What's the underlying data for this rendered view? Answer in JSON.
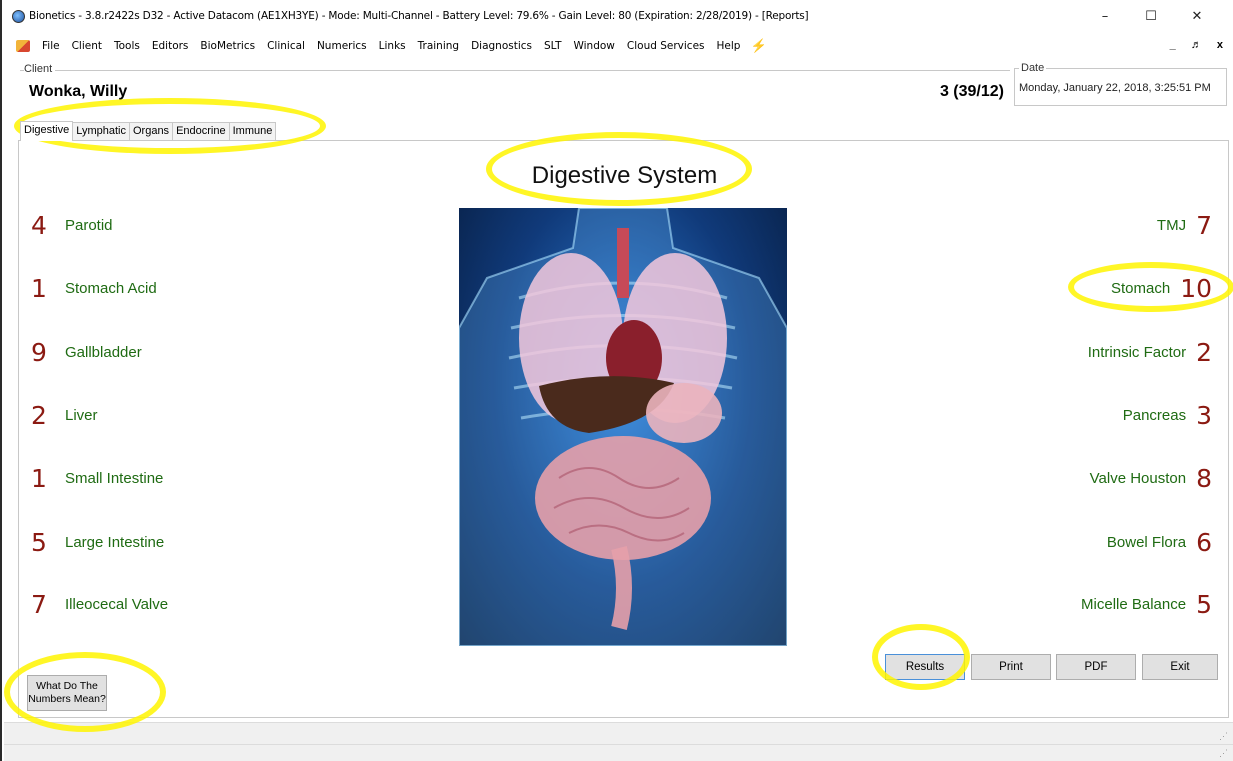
{
  "window": {
    "title": "Bionetics - 3.8.r2422s D32 - Active Datacom (AE1XH3YE) - Mode: Multi-Channel - Battery Level: 79.6% - Gain Level: 80 (Expiration: 2/28/2019) - [Reports]",
    "minimize": "–",
    "maximize": "☐",
    "close": "✕"
  },
  "menu": {
    "items": [
      "File",
      "Client",
      "Tools",
      "Editors",
      "BioMetrics",
      "Clinical",
      "Numerics",
      "Links",
      "Training",
      "Diagnostics",
      "SLT",
      "Window",
      "Cloud Services",
      "Help"
    ],
    "mdi_controls": "_ ♬ x"
  },
  "client": {
    "caption": "Client",
    "name": "Wonka, Willy",
    "count": "3 (39/12)"
  },
  "date": {
    "caption": "Date",
    "value": "Monday, January 22, 2018, 3:25:51 PM"
  },
  "tabs": [
    {
      "label": "Digestive",
      "active": true
    },
    {
      "label": "Lymphatic",
      "active": false
    },
    {
      "label": "Organs",
      "active": false
    },
    {
      "label": "Endocrine",
      "active": false
    },
    {
      "label": "Immune",
      "active": false
    }
  ],
  "heading": "Digestive System",
  "left_items": [
    {
      "num": "4",
      "label": "Parotid"
    },
    {
      "num": "1",
      "label": "Stomach Acid"
    },
    {
      "num": "9",
      "label": "Gallbladder"
    },
    {
      "num": "2",
      "label": "Liver"
    },
    {
      "num": "1",
      "label": "Small Intestine"
    },
    {
      "num": "5",
      "label": "Large Intestine"
    },
    {
      "num": "7",
      "label": "Illeocecal Valve"
    }
  ],
  "right_items": [
    {
      "num": "7",
      "label": "TMJ"
    },
    {
      "num": "10",
      "label": "Stomach"
    },
    {
      "num": "2",
      "label": "Intrinsic Factor"
    },
    {
      "num": "3",
      "label": "Pancreas"
    },
    {
      "num": "8",
      "label": "Valve Houston"
    },
    {
      "num": "6",
      "label": "Bowel Flora"
    },
    {
      "num": "5",
      "label": "Micelle Balance"
    }
  ],
  "buttons": {
    "what": "What Do The Numbers Mean?",
    "results": "Results",
    "print": "Print",
    "pdf": "PDF",
    "exit": "Exit"
  },
  "colors": {
    "number": "#8b1a12",
    "label": "#1f6b13",
    "highlight": "#fff500"
  }
}
